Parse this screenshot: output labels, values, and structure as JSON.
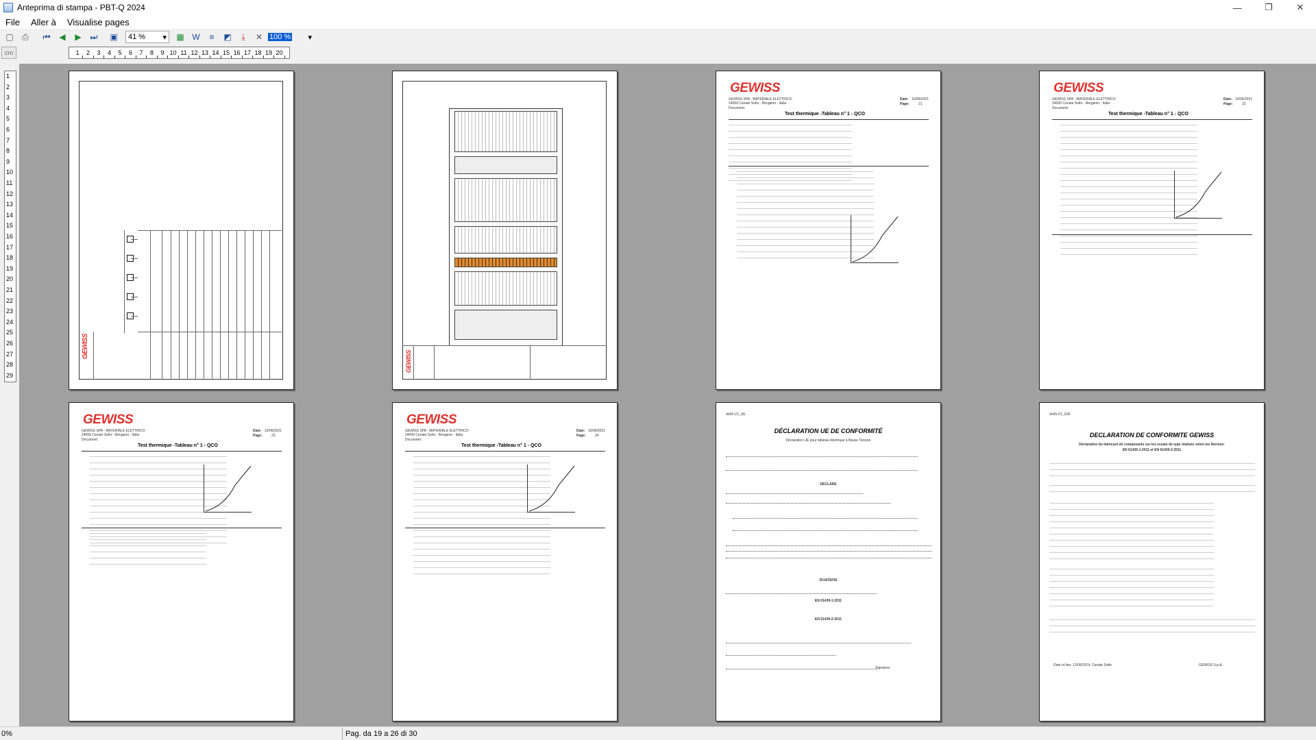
{
  "window": {
    "title": "Anteprima di stampa - PBT-Q 2024",
    "controls": {
      "minimize": "—",
      "maximize": "❐",
      "close": "✕"
    }
  },
  "menu": [
    "File",
    "Aller à",
    "Visualise pages"
  ],
  "toolbar": {
    "zoom_value": "41 %",
    "zoom2_value": "100 %",
    "icons": [
      "new-icon",
      "print-icon",
      "first-page-icon",
      "prev-page-icon",
      "next-page-icon",
      "last-page-icon",
      "save-icon",
      "excel-icon",
      "word-icon",
      "text-icon",
      "pdf-image-icon",
      "pdf-icon",
      "close-icon"
    ]
  },
  "ruler": {
    "unit_button": "cm",
    "h_ticks": [
      "1",
      "2",
      "3",
      "4",
      "5",
      "6",
      "7",
      "8",
      "9",
      "10",
      "11",
      "12",
      "13",
      "14",
      "15",
      "16",
      "17",
      "18",
      "19",
      "20"
    ],
    "v_ticks": [
      "1",
      "2",
      "3",
      "4",
      "5",
      "6",
      "7",
      "8",
      "9",
      "10",
      "11",
      "12",
      "13",
      "14",
      "15",
      "16",
      "17",
      "18",
      "19",
      "20",
      "21",
      "22",
      "23",
      "24",
      "25",
      "26",
      "27",
      "28",
      "29"
    ]
  },
  "pages": {
    "p3": {
      "brand": "GEWISS",
      "company": "GEWISS SPA - MATERIALE ELETTRICO",
      "address": "24069 Cenate Sotto - Bergamo - Italia",
      "doc_label": "Document:",
      "date_label": "Date:",
      "date": "10/06/2021",
      "page_label": "Page:",
      "page": "21",
      "title": "Test thermique -Tableau n° 1 - QCO"
    },
    "p4": {
      "brand": "GEWISS",
      "company": "GEWISS SPA - MATERIALE ELETTRICO",
      "address": "24069 Cenate Sotto - Bergamo - Italia",
      "doc_label": "Document:",
      "date_label": "Date:",
      "date": "10/06/2021",
      "page_label": "Page:",
      "page": "22",
      "title": "Test thermique -Tableau n° 1 - QCO"
    },
    "p5": {
      "brand": "GEWISS",
      "company": "GEWISS SPA - MATERIALE ELETTRICO",
      "address": "24069 Cenate Sotto - Bergamo - Italia",
      "doc_label": "Document:",
      "date_label": "Date:",
      "date": "10/06/2021",
      "page_label": "Page:",
      "page": "23",
      "title": "Test thermique -Tableau n° 1 - QCO"
    },
    "p6": {
      "brand": "GEWISS",
      "company": "GEWISS SPA - MATERIALE ELETTRICO",
      "address": "24069 Cenate Sotto - Bergamo - Italia",
      "doc_label": "Document:",
      "date_label": "Date:",
      "date": "10/06/2021",
      "page_label": "Page:",
      "page": "24",
      "title": "Test thermique -Tableau n° 1 - QCO"
    },
    "p7": {
      "ref": "dn65-V2_UE",
      "title": "DÉCLARATION UE DE CONFORMITÉ",
      "subtitle": "Déclaration UE pour tableau électrique à Basse Tension",
      "declare": "DECLARE",
      "directive": "2014/35/UE",
      "norm1": "EN 61439-1:2011",
      "norm2": "EN 61439-2:2011",
      "signature": "Signature"
    },
    "p8": {
      "ref": "dn65-V2_GW",
      "title": "DECLARATION DE CONFORMITE GEWISS",
      "subtitle": "Déclaration du fabricant de composants sur les essais de type réalisés selon les Normes:",
      "norms": "EN 61439-1:2011 et EN 61439-2:2011",
      "footer_date": "Date et lieu: 12/09/2014, Cenate Sotto",
      "footer_company": "GEWISS S.p.A."
    }
  },
  "status": {
    "progress": "0%",
    "pages": "Pag. da 19 a 26 di 30"
  },
  "colors": {
    "brand_red": "#e0302b",
    "canvas": "#a0a0a0",
    "selection": "#0a5bd7"
  }
}
